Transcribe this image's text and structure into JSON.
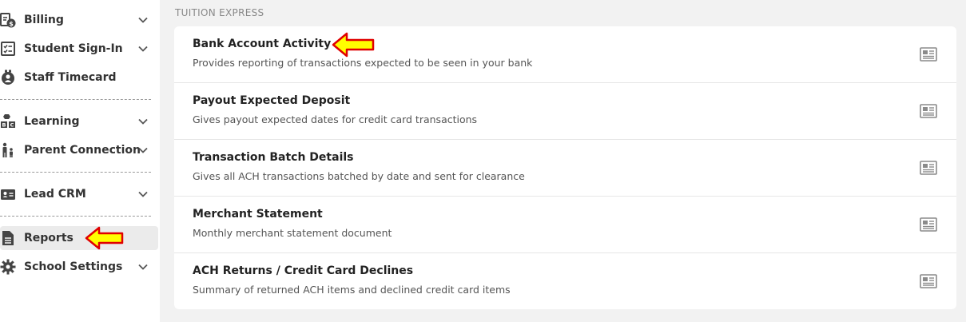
{
  "sidebar": {
    "items": [
      {
        "label": "Billing",
        "icon": "billing-icon",
        "has_chevron": true
      },
      {
        "label": "Student Sign-In",
        "icon": "checklist-icon",
        "has_chevron": true
      },
      {
        "label": "Staff Timecard",
        "icon": "timecard-icon",
        "has_chevron": false
      },
      {
        "label": "Learning",
        "icon": "abc-blocks-icon",
        "has_chevron": true
      },
      {
        "label": "Parent Connection",
        "icon": "family-icon",
        "has_chevron": true
      },
      {
        "label": "Lead CRM",
        "icon": "contact-card-icon",
        "has_chevron": true
      },
      {
        "label": "Reports",
        "icon": "document-icon",
        "has_chevron": false,
        "active": true
      },
      {
        "label": "School Settings",
        "icon": "gear-icon",
        "has_chevron": true
      }
    ]
  },
  "main": {
    "section_title": "TUITION EXPRESS",
    "reports": [
      {
        "title": "Bank Account Activity",
        "description": "Provides reporting of transactions expected to be seen in your bank"
      },
      {
        "title": "Payout Expected Deposit",
        "description": "Gives payout expected dates for credit card transactions"
      },
      {
        "title": "Transaction Batch Details",
        "description": "Gives all ACH transactions batched by date and sent for clearance"
      },
      {
        "title": "Merchant Statement",
        "description": "Monthly merchant statement document"
      },
      {
        "title": "ACH Returns / Credit Card Declines",
        "description": "Summary of returned ACH items and declined credit card items"
      }
    ]
  },
  "colors": {
    "sidebar_bg": "#ffffff",
    "page_bg": "#f2f2f2",
    "active_bg": "#ebebeb",
    "annotation_arrow_fill": "#ffff00",
    "annotation_arrow_stroke": "#e00000"
  }
}
